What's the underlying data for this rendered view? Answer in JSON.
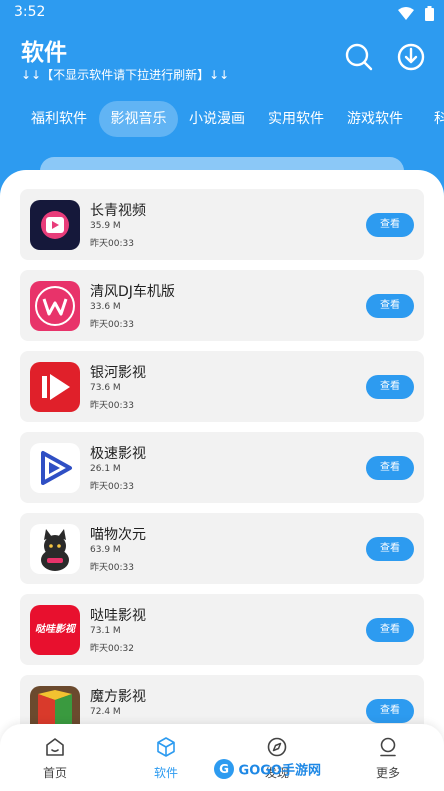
{
  "status": {
    "time": "3:52"
  },
  "header": {
    "title": "软件",
    "subtitle": "↓↓【不显示软件请下拉进行刷新】↓↓"
  },
  "tabs": [
    {
      "label": "福利软件",
      "active": false
    },
    {
      "label": "影视音乐",
      "active": true
    },
    {
      "label": "小说漫画",
      "active": false
    },
    {
      "label": "实用软件",
      "active": false
    },
    {
      "label": "游戏软件",
      "active": false
    },
    {
      "label": "科学",
      "active": false
    }
  ],
  "apps": [
    {
      "name": "长青视频",
      "size": "35.9 M",
      "time": "昨天00:33",
      "button": "查看",
      "icon": "play-icon"
    },
    {
      "name": "清风DJ车机版",
      "size": "33.6 M",
      "time": "昨天00:33",
      "button": "查看",
      "icon": "w-logo-icon"
    },
    {
      "name": "银河影视",
      "size": "73.6 M",
      "time": "昨天00:33",
      "button": "查看",
      "icon": "play-icon"
    },
    {
      "name": "极速影视",
      "size": "26.1 M",
      "time": "昨天00:33",
      "button": "查看",
      "icon": "triangle-play-icon"
    },
    {
      "name": "喵物次元",
      "size": "63.9 M",
      "time": "昨天00:33",
      "button": "查看",
      "icon": "cat-icon"
    },
    {
      "name": "哒哇影视",
      "size": "73.1 M",
      "time": "昨天00:32",
      "button": "查看",
      "icon": "text-logo-icon",
      "icon_text": "哒哇影视"
    },
    {
      "name": "魔方影视",
      "size": "72.4 M",
      "time": "",
      "button": "查看",
      "icon": "cube-icon"
    }
  ],
  "bottom_nav": [
    {
      "label": "首页",
      "icon": "home-icon",
      "active": false
    },
    {
      "label": "软件",
      "icon": "cube-icon",
      "active": true
    },
    {
      "label": "发现",
      "icon": "compass-icon",
      "active": false
    },
    {
      "label": "更多",
      "icon": "user-icon",
      "active": false
    }
  ],
  "watermark": {
    "text": "GOGO手游网"
  },
  "colors": {
    "accent": "#2d9bf0",
    "card_bg": "#f2f2f2"
  }
}
